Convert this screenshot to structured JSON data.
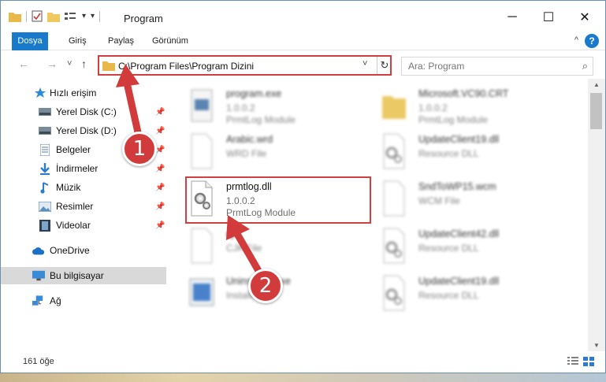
{
  "window": {
    "title": "Program",
    "minimize": "─",
    "maximize": "☐",
    "close": "✕"
  },
  "ribbon": {
    "tabs": [
      "Dosya",
      "Giriş",
      "Paylaş",
      "Görünüm"
    ],
    "help": "?",
    "collapse": "^"
  },
  "nav": {
    "back": "←",
    "forward": "→",
    "recent": "˅",
    "up": "↑",
    "address": "C:\\Program Files\\Program Dizini",
    "address_dropdown": "˅",
    "refresh": "↻",
    "search_placeholder": "Ara: Program",
    "search_icon": "⌕"
  },
  "sidebar": {
    "items": [
      {
        "label": "Hızlı erişim",
        "icon": "star-icon",
        "pinned": false
      },
      {
        "label": "Yerel Disk (C:)",
        "icon": "drive-icon",
        "pinned": true
      },
      {
        "label": "Yerel Disk (D:)",
        "icon": "drive-icon",
        "pinned": true
      },
      {
        "label": "Belgeler",
        "icon": "documents-icon",
        "pinned": true
      },
      {
        "label": "İndirmeler",
        "icon": "download-icon",
        "pinned": true
      },
      {
        "label": "Müzik",
        "icon": "music-icon",
        "pinned": true
      },
      {
        "label": "Resimler",
        "icon": "pictures-icon",
        "pinned": true
      },
      {
        "label": "Videolar",
        "icon": "videos-icon",
        "pinned": true
      },
      {
        "label": "OneDrive",
        "icon": "onedrive-icon",
        "pinned": false
      },
      {
        "label": "Bu bilgisayar",
        "icon": "computer-icon",
        "pinned": false
      },
      {
        "label": "Ağ",
        "icon": "network-icon",
        "pinned": false
      }
    ],
    "pin_glyph": "📌"
  },
  "files": [
    {
      "name": "program.exe",
      "line2": "1.0.0.2",
      "line3": "PrmtLog Module",
      "icon": "exe-icon",
      "blurred": true
    },
    {
      "name": "Microsoft.VC90.CRT",
      "line2": "1.0.0.2",
      "line3": "PrmtLog Module",
      "icon": "folder-icon",
      "blurred": true
    },
    {
      "name": "Arabic.wrd",
      "line2": "WRD File",
      "line3": "",
      "icon": "blank-file-icon",
      "blurred": true
    },
    {
      "name": "UpdateClient19.dll",
      "line2": "Resource DLL",
      "line3": "",
      "icon": "dll-icon",
      "blurred": true
    },
    {
      "name": "prmtlog.dll",
      "line2": "1.0.0.2",
      "line3": "PrmtLog Module",
      "icon": "dll-icon",
      "blurred": false
    },
    {
      "name": "SndToWP15.wcm",
      "line2": "WCM File",
      "line3": "",
      "icon": "blank-file-icon",
      "blurred": true
    },
    {
      "name": "cjk",
      "line2": "CJK File",
      "line3": "",
      "icon": "blank-file-icon",
      "blurred": true
    },
    {
      "name": "UpdateClient42.dll",
      "line2": "Resource DLL",
      "line3": "",
      "icon": "dll-icon",
      "blurred": true
    },
    {
      "name": "Uninstaller.exe",
      "line2": "Installer",
      "line3": "",
      "icon": "installer-icon",
      "blurred": true
    },
    {
      "name": "UpdateClient19.dll",
      "line2": "Resource DLL",
      "line3": "",
      "icon": "dll-icon",
      "blurred": true
    }
  ],
  "status": {
    "item_count": "161 öğe"
  },
  "callouts": [
    "1",
    "2"
  ],
  "colors": {
    "accent": "#1979ca",
    "highlight": "#d04040",
    "callout": "#d23b3b"
  }
}
